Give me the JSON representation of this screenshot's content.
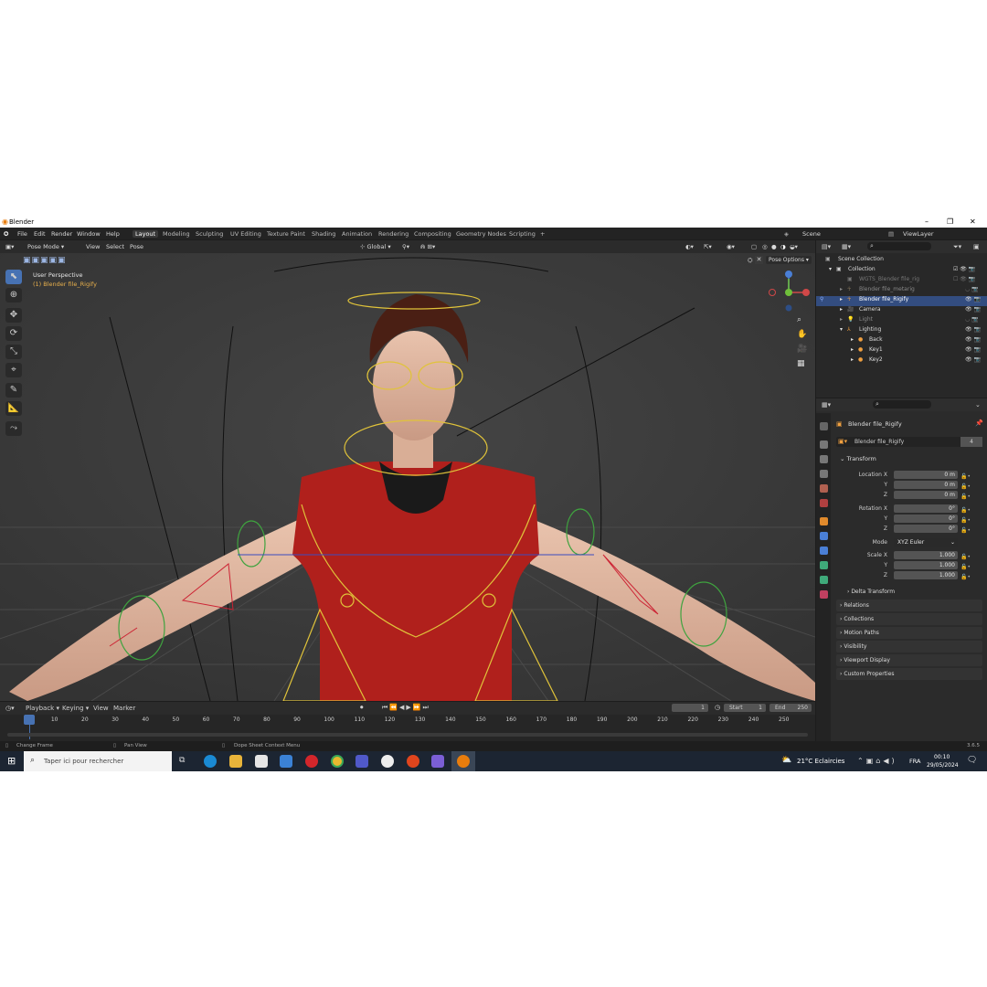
{
  "window": {
    "title": "Blender",
    "controls": [
      "–",
      "❐",
      "✕"
    ]
  },
  "menus": [
    "File",
    "Edit",
    "Render",
    "Window",
    "Help"
  ],
  "workspaces": [
    "Layout",
    "Modeling",
    "Sculpting",
    "UV Editing",
    "Texture Paint",
    "Shading",
    "Animation",
    "Rendering",
    "Compositing",
    "Geometry Nodes",
    "Scripting",
    "+"
  ],
  "active_workspace": "Layout",
  "scene": {
    "name": "Scene",
    "view_layer": "ViewLayer"
  },
  "viewport_header": {
    "mode": "Pose Mode",
    "menus": [
      "View",
      "Select",
      "Pose"
    ],
    "orientation": "Global",
    "pose_options": "Pose Options"
  },
  "viewport": {
    "perspective": "User Perspective",
    "active_object": "(1) Blender file_Rigify"
  },
  "outliner": {
    "rows": [
      {
        "name": "Scene Collection"
      },
      {
        "name": "Collection"
      },
      {
        "name": "WGTS_Blender file_rig"
      },
      {
        "name": "Blender file_metarig"
      },
      {
        "name": "Blender file_Rigify"
      },
      {
        "name": "Camera"
      },
      {
        "name": "Light"
      },
      {
        "name": "Lighting"
      },
      {
        "name": "Back"
      },
      {
        "name": "Key1"
      },
      {
        "name": "Key2"
      }
    ]
  },
  "properties": {
    "object_name": "Blender file_Rigify",
    "data_name": "Blender file_Rigify",
    "users": "4",
    "transform_title": "Transform",
    "location": {
      "label": "Location X",
      "x": "0 m",
      "y": "0 m",
      "z": "0 m"
    },
    "rotation": {
      "label": "Rotation X",
      "x": "0°",
      "y": "0°",
      "z": "0°"
    },
    "mode": {
      "label": "Mode",
      "value": "XYZ Euler"
    },
    "scale": {
      "label": "Scale X",
      "x": "1.000",
      "y": "1.000",
      "z": "1.000"
    },
    "axis_labels": {
      "y": "Y",
      "z": "Z"
    },
    "delta": "Delta Transform",
    "sections": [
      "Relations",
      "Collections",
      "Motion Paths",
      "Visibility",
      "Viewport Display",
      "Custom Properties"
    ]
  },
  "timeline": {
    "menus": [
      "Playback",
      "Keying",
      "View",
      "Marker"
    ],
    "current_frame": "1",
    "start_label": "Start",
    "start": "1",
    "end_label": "End",
    "end": "250",
    "ticks": [
      "1",
      "10",
      "20",
      "30",
      "40",
      "50",
      "60",
      "70",
      "80",
      "90",
      "100",
      "110",
      "120",
      "130",
      "140",
      "150",
      "160",
      "170",
      "180",
      "190",
      "200",
      "210",
      "220",
      "230",
      "240",
      "250"
    ]
  },
  "statusbar": {
    "left": "Change Frame",
    "mid": "Pan View",
    "right": "Dope Sheet Context Menu",
    "version": "3.6.5"
  },
  "taskbar": {
    "search_placeholder": "Taper ici pour rechercher",
    "weather": "21°C  Eclaircies",
    "lang": "FRA",
    "time": "00:10",
    "date": "29/05/2024"
  }
}
